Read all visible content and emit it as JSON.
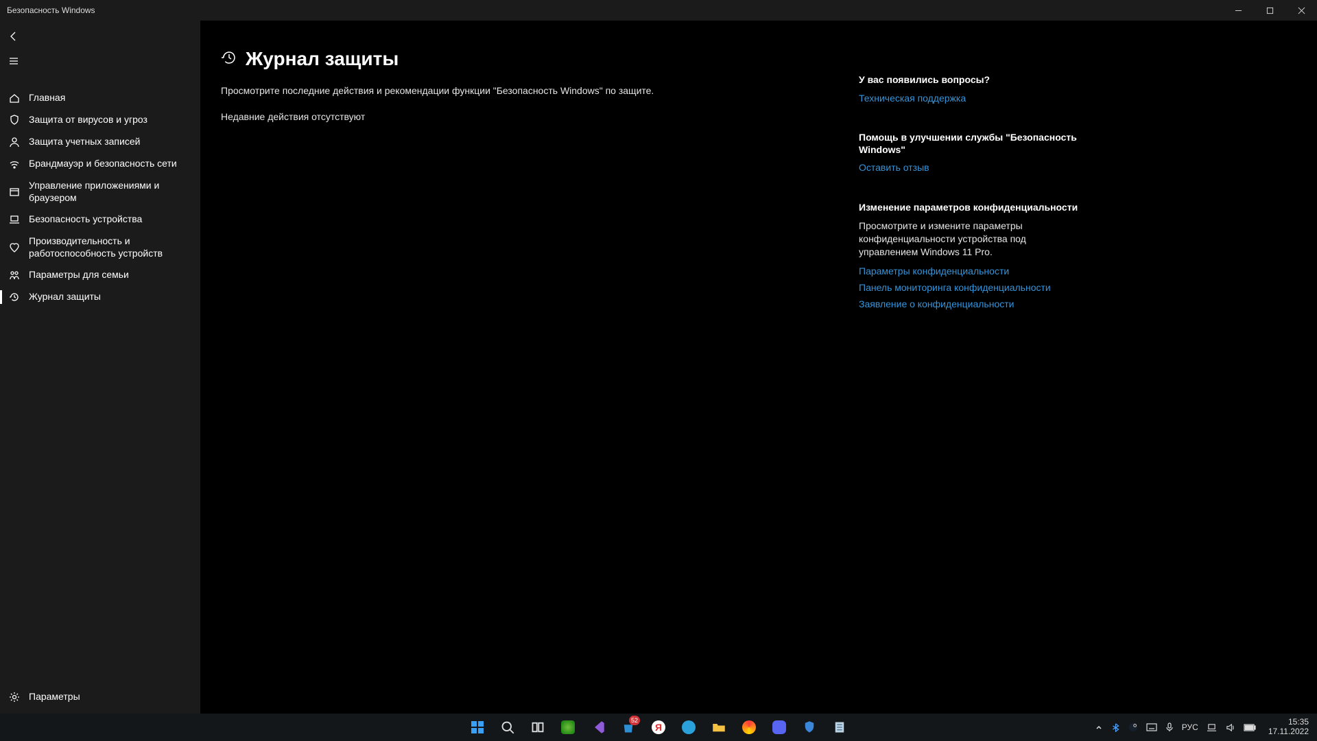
{
  "window": {
    "title": "Безопасность Windows"
  },
  "sidebar": {
    "home": {
      "label": "Главная"
    },
    "virus": {
      "label": "Защита от вирусов и угроз"
    },
    "account": {
      "label": "Защита учетных записей"
    },
    "firewall": {
      "label": "Брандмауэр и безопасность сети"
    },
    "appctrl": {
      "label": "Управление приложениями и браузером"
    },
    "devsec": {
      "label": "Безопасность устройства"
    },
    "perf": {
      "label": "Производительность и работоспособность устройств"
    },
    "family": {
      "label": "Параметры для семьи"
    },
    "history": {
      "label": "Журнал защиты"
    },
    "settings": {
      "label": "Параметры"
    }
  },
  "page": {
    "title": "Журнал защиты",
    "description": "Просмотрите последние действия и рекомендации функции \"Безопасность Windows\" по защите.",
    "no_recent": "Недавние действия отсутствуют"
  },
  "right": {
    "q": {
      "heading": "У вас появились вопросы?",
      "link": "Техническая поддержка"
    },
    "feedback": {
      "heading": "Помощь в улучшении службы \"Безопасность Windows\"",
      "link": "Оставить отзыв"
    },
    "privacy": {
      "heading": "Изменение параметров конфиденциальности",
      "text": "Просмотрите и измените параметры конфиденциальности устройства под управлением Windows 11 Pro.",
      "link1": "Параметры конфиденциальности",
      "link2": "Панель мониторинга конфиденциальности",
      "link3": "Заявление о конфиденциальности"
    }
  },
  "taskbar": {
    "search_badge": "52",
    "tray": {
      "lang": "РУС",
      "time": "15:35",
      "date": "17.11.2022"
    }
  }
}
